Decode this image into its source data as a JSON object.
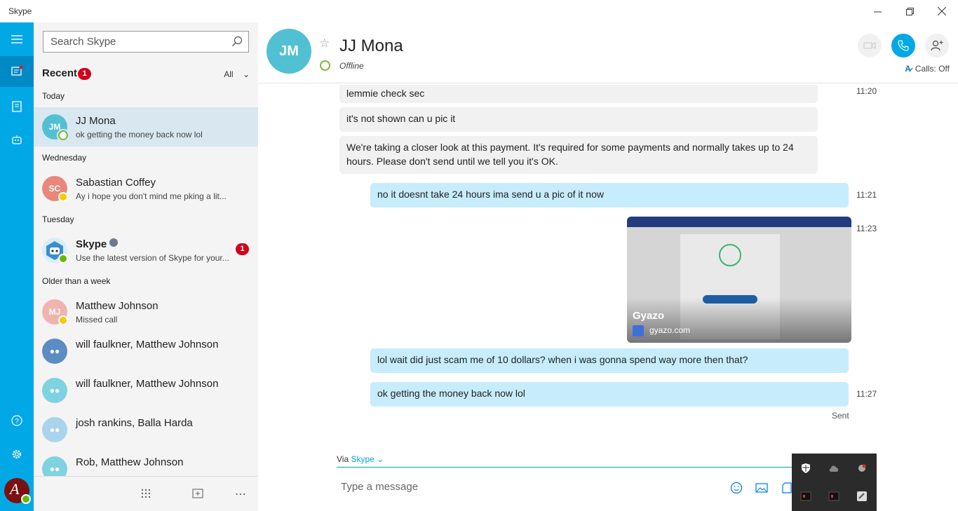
{
  "window": {
    "title": "Skype"
  },
  "search": {
    "placeholder": "Search Skype"
  },
  "recent": {
    "title": "Recent",
    "badge": "1",
    "filter": "All"
  },
  "sections": {
    "today": "Today",
    "wednesday": "Wednesday",
    "tuesday": "Tuesday",
    "older": "Older than a week"
  },
  "contacts": [
    {
      "initials": "JM",
      "name": "JJ Mona",
      "preview": "ok getting the money back now lol",
      "avatar_color": "#52c0d3",
      "presence": "offline"
    },
    {
      "initials": "SC",
      "name": "Sabastian Coffey",
      "preview": "Ay i hope you don't mind me pking a lit...",
      "avatar_color": "#e8877a",
      "presence": "away"
    },
    {
      "initials": "",
      "name": "Skype",
      "preview": "Use the latest version of Skype for your...",
      "badge": "1",
      "presence": "online"
    },
    {
      "initials": "MJ",
      "name": "Matthew Johnson",
      "preview": "Missed call",
      "avatar_color": "#f0b4b0",
      "presence": "away"
    },
    {
      "initials": "",
      "name": "will faulkner, Matthew Johnson",
      "preview": "",
      "avatar_color": "#5b8cc4"
    },
    {
      "initials": "",
      "name": "will faulkner, Matthew Johnson",
      "preview": "",
      "avatar_color": "#7fd3e0"
    },
    {
      "initials": "",
      "name": "josh rankins, Balla Harda",
      "preview": "",
      "avatar_color": "#a9d4ec"
    },
    {
      "initials": "",
      "name": "Rob, Matthew Johnson",
      "preview": "",
      "avatar_color": "#7fd3e0"
    }
  ],
  "chat": {
    "initials": "JM",
    "name": "JJ Mona",
    "status": "Offline",
    "calls_label": "Calls: Off"
  },
  "messages": [
    {
      "dir": "in",
      "text": "lemmie check sec",
      "time": "11:20"
    },
    {
      "dir": "in",
      "text": "it's not shown can u pic it",
      "time": ""
    },
    {
      "dir": "in",
      "text": "We're taking a closer look at this payment. It's required for some payments and normally takes up to 24 hours. Please don't send until we tell you it's OK.",
      "time": ""
    },
    {
      "dir": "out",
      "text": "no it doesnt take 24 hours ima send u a pic of it now",
      "time": "11:21"
    },
    {
      "dir": "out",
      "text": "",
      "time": "11:23"
    },
    {
      "dir": "out",
      "text": "lol wait did just scam me of 10 dollars? when i was gonna spend way more then that?",
      "time": ""
    },
    {
      "dir": "out",
      "text": "ok getting the money back now lol",
      "time": "11:27"
    }
  ],
  "link_preview": {
    "title": "Gyazo",
    "site": "gyazo.com"
  },
  "sent_label": "Sent",
  "compose": {
    "via_label": "Via",
    "via_service": "Skype",
    "placeholder": "Type a message"
  },
  "colors": {
    "brand": "#00a8e6",
    "rail_active": "#0089c5",
    "bubble_out": "#c7edfc",
    "bubble_in": "#f1f1f1",
    "badge": "#d0021b"
  }
}
